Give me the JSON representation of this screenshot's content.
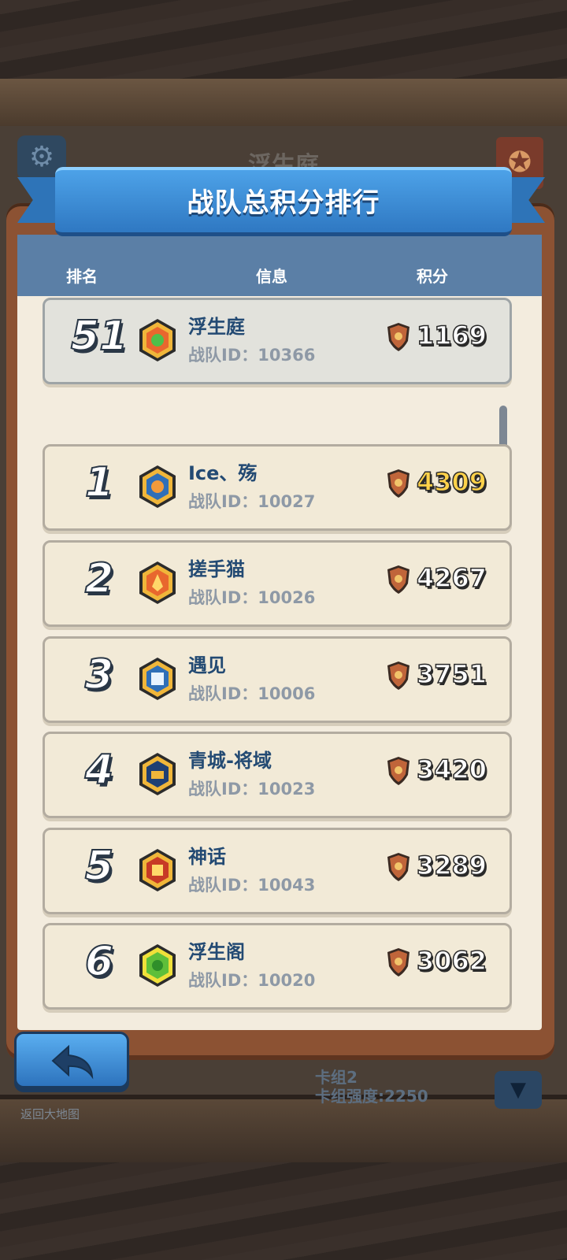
{
  "background": {
    "behind_title": "浮生庭",
    "behind_deck_name": "卡组2",
    "behind_deck_power": "卡组强度:2250",
    "behind_return_label": "返回大地图"
  },
  "dialog": {
    "title": "战队总积分排行",
    "columns": {
      "rank": "排名",
      "info": "信息",
      "score": "积分"
    }
  },
  "my_team": {
    "rank": "51",
    "name": "浮生庭",
    "id_label": "战队ID：10366",
    "score": "1169",
    "emblem": "orange-green"
  },
  "rankings": [
    {
      "rank": "1",
      "name": "Ice、殇",
      "id_label": "战队ID：10027",
      "score": "4309",
      "emblem": "blue-orange",
      "highlight": true
    },
    {
      "rank": "2",
      "name": "搓手猫",
      "id_label": "战队ID：10026",
      "score": "4267",
      "emblem": "orange-flame"
    },
    {
      "rank": "3",
      "name": "遇见",
      "id_label": "战队ID：10006",
      "score": "3751",
      "emblem": "blue-white"
    },
    {
      "rank": "4",
      "name": "青城-将域",
      "id_label": "战队ID：10023",
      "score": "3420",
      "emblem": "navy-gold"
    },
    {
      "rank": "5",
      "name": "神话",
      "id_label": "战队ID：10043",
      "score": "3289",
      "emblem": "red-gold"
    },
    {
      "rank": "6",
      "name": "浮生阁",
      "id_label": "战队ID：10020",
      "score": "3062",
      "emblem": "green"
    }
  ],
  "colors": {
    "ribbon": "#3a8bd6",
    "header_band": "#5b7fa6",
    "gold_score": "#ffd24a",
    "name_text": "#234a73"
  }
}
